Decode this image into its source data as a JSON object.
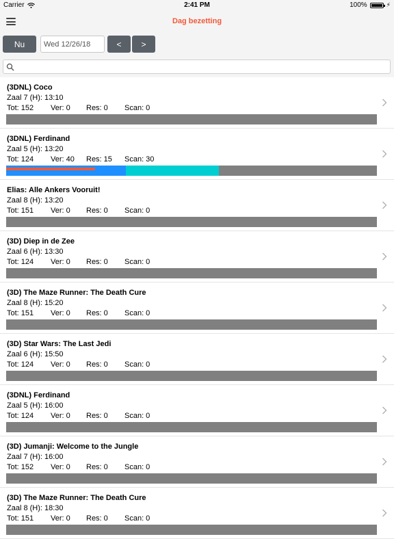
{
  "status_bar": {
    "carrier": "Carrier",
    "time": "2:41 PM",
    "battery": "100%"
  },
  "nav": {
    "title": "Dag bezetting"
  },
  "toolbar": {
    "now_label": "Nu",
    "date_value": "Wed 12/26/18",
    "prev_label": "<",
    "next_label": ">"
  },
  "search": {
    "placeholder": ""
  },
  "colors": {
    "accent": "#f05a3a",
    "button": "#5a6068",
    "bar_empty": "#808080",
    "sold": "#f05a3a",
    "reserved": "#1e90ff",
    "scanned": "#00ced1"
  },
  "shows": [
    {
      "title": "(3DNL) Coco",
      "zaal": "Zaal 7 (H): 13:10",
      "tot": "Tot: 152",
      "ver": "Ver: 0",
      "res": "Res: 0",
      "scan": "Scan: 0",
      "total": 152,
      "sold": 0,
      "reserved": 0,
      "scanned": 0
    },
    {
      "title": "(3DNL) Ferdinand",
      "zaal": "Zaal 5 (H): 13:20",
      "tot": "Tot: 124",
      "ver": "Ver: 40",
      "res": "Res: 15",
      "scan": "Scan: 30",
      "total": 124,
      "sold": 40,
      "reserved": 15,
      "scanned": 30
    },
    {
      "title": "Elias: Alle Ankers Vooruit!",
      "zaal": "Zaal 8 (H): 13:20",
      "tot": "Tot: 151",
      "ver": "Ver: 0",
      "res": "Res: 0",
      "scan": "Scan: 0",
      "total": 151,
      "sold": 0,
      "reserved": 0,
      "scanned": 0
    },
    {
      "title": "(3D) Diep in de Zee",
      "zaal": "Zaal 6 (H): 13:30",
      "tot": "Tot: 124",
      "ver": "Ver: 0",
      "res": "Res: 0",
      "scan": "Scan: 0",
      "total": 124,
      "sold": 0,
      "reserved": 0,
      "scanned": 0
    },
    {
      "title": "(3D) The Maze Runner: The Death Cure",
      "zaal": "Zaal 8 (H): 15:20",
      "tot": "Tot: 151",
      "ver": "Ver: 0",
      "res": "Res: 0",
      "scan": "Scan: 0",
      "total": 151,
      "sold": 0,
      "reserved": 0,
      "scanned": 0
    },
    {
      "title": "(3D) Star Wars: The Last Jedi",
      "zaal": "Zaal 6 (H): 15:50",
      "tot": "Tot: 124",
      "ver": "Ver: 0",
      "res": "Res: 0",
      "scan": "Scan: 0",
      "total": 124,
      "sold": 0,
      "reserved": 0,
      "scanned": 0
    },
    {
      "title": "(3DNL) Ferdinand",
      "zaal": "Zaal 5 (H): 16:00",
      "tot": "Tot: 124",
      "ver": "Ver: 0",
      "res": "Res: 0",
      "scan": "Scan: 0",
      "total": 124,
      "sold": 0,
      "reserved": 0,
      "scanned": 0
    },
    {
      "title": "(3D) Jumanji: Welcome to the Jungle",
      "zaal": "Zaal 7 (H): 16:00",
      "tot": "Tot: 152",
      "ver": "Ver: 0",
      "res": "Res: 0",
      "scan": "Scan: 0",
      "total": 152,
      "sold": 0,
      "reserved": 0,
      "scanned": 0
    },
    {
      "title": "(3D) The Maze Runner: The Death Cure",
      "zaal": "Zaal 8 (H): 18:30",
      "tot": "Tot: 151",
      "ver": "Ver: 0",
      "res": "Res: 0",
      "scan": "Scan: 0",
      "total": 151,
      "sold": 0,
      "reserved": 0,
      "scanned": 0
    }
  ]
}
